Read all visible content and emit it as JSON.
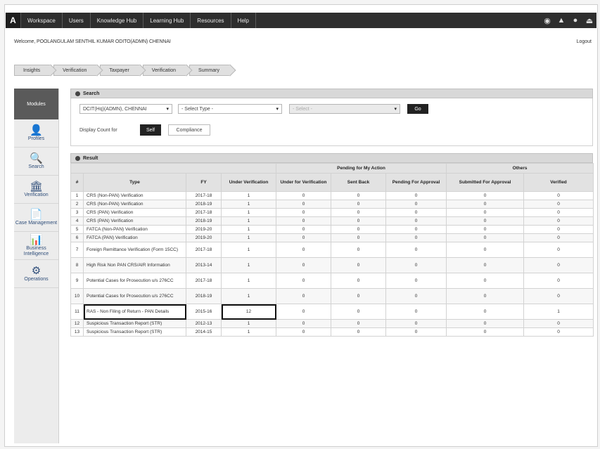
{
  "topbar": {
    "home": "A",
    "nav": [
      "Workspace",
      "Users",
      "Knowledge Hub",
      "Learning Hub",
      "Resources",
      "Help"
    ]
  },
  "welcome": {
    "text": "Welcome, POOLANGULAM SENTHIL KUMAR ODITO(ADMN) CHENNAI",
    "logout": "Logout"
  },
  "breadcrumbs": [
    "Insights",
    "Verification",
    "Taxpayer",
    "Verification",
    "Summary"
  ],
  "sidebar": {
    "header": "Modules",
    "items": [
      {
        "label": "Profiles",
        "icon": "👤"
      },
      {
        "label": "Search",
        "icon": "🔍"
      },
      {
        "label": "Verification",
        "icon": "🏛"
      },
      {
        "label": "Case Management",
        "icon": "📄"
      },
      {
        "label": "Business Intelligence",
        "icon": "📊"
      },
      {
        "label": "Operations",
        "icon": "⚙"
      }
    ]
  },
  "search": {
    "title": "Search",
    "jurisdiction": "DCIT(Hq)(ADMN), CHENNAI",
    "type_placeholder": "- Select Type -",
    "third_placeholder": "- Select -",
    "go": "Go",
    "display_label": "Display Count for",
    "self": "Self",
    "compliance": "Compliance"
  },
  "result": {
    "title": "Result",
    "headers": {
      "num": "#",
      "type": "Type",
      "fy": "FY",
      "under_verification": "Under Verification",
      "group_pending": "Pending for My Action",
      "group_others": "Others",
      "under_for_verification": "Under for Verification",
      "sent_back": "Sent Back",
      "pending_approval": "Pending For Approval",
      "submitted_approval": "Submitted For Approval",
      "verified": "Verified"
    },
    "rows": [
      {
        "n": "1",
        "type": "CRS (Non-PAN) Verification",
        "fy": "2017-18",
        "uv": "1",
        "ufv": "0",
        "sb": "0",
        "pa": "0",
        "sa": "0",
        "v": "0"
      },
      {
        "n": "2",
        "type": "CRS (Non-PAN) Verification",
        "fy": "2018-19",
        "uv": "1",
        "ufv": "0",
        "sb": "0",
        "pa": "0",
        "sa": "0",
        "v": "0"
      },
      {
        "n": "3",
        "type": "CRS (PAN) Verification",
        "fy": "2017-18",
        "uv": "1",
        "ufv": "0",
        "sb": "0",
        "pa": "0",
        "sa": "0",
        "v": "0"
      },
      {
        "n": "4",
        "type": "CRS (PAN) Verification",
        "fy": "2018-19",
        "uv": "1",
        "ufv": "0",
        "sb": "0",
        "pa": "0",
        "sa": "0",
        "v": "0"
      },
      {
        "n": "5",
        "type": "FATCA (Non-PAN) Verification",
        "fy": "2019-20",
        "uv": "1",
        "ufv": "0",
        "sb": "0",
        "pa": "0",
        "sa": "0",
        "v": "0"
      },
      {
        "n": "6",
        "type": "FATCA (PAN) Verification",
        "fy": "2019-20",
        "uv": "1",
        "ufv": "0",
        "sb": "0",
        "pa": "0",
        "sa": "0",
        "v": "0"
      },
      {
        "n": "7",
        "type": "Foreign Remittance Verification (Form 15CC)",
        "fy": "2017-18",
        "uv": "1",
        "ufv": "0",
        "sb": "0",
        "pa": "0",
        "sa": "0",
        "v": "0"
      },
      {
        "n": "8",
        "type": "High Risk Non PAN CRS/AIR Information",
        "fy": "2013-14",
        "uv": "1",
        "ufv": "0",
        "sb": "0",
        "pa": "0",
        "sa": "0",
        "v": "0"
      },
      {
        "n": "9",
        "type": "Potential Cases for Prosecution u/s 276CC",
        "fy": "2017-18",
        "uv": "1",
        "ufv": "0",
        "sb": "0",
        "pa": "0",
        "sa": "0",
        "v": "0"
      },
      {
        "n": "10",
        "type": "Potential Cases for Prosecution u/s 276CC",
        "fy": "2018-19",
        "uv": "1",
        "ufv": "0",
        "sb": "0",
        "pa": "0",
        "sa": "0",
        "v": "0"
      },
      {
        "n": "11",
        "type": "RAS - Non Filing of Return - PAN Details",
        "fy": "2015-16",
        "uv": "12",
        "ufv": "0",
        "sb": "0",
        "pa": "0",
        "sa": "0",
        "v": "1"
      },
      {
        "n": "12",
        "type": "Suspicious Transaction Report (STR)",
        "fy": "2012-13",
        "uv": "1",
        "ufv": "0",
        "sb": "0",
        "pa": "0",
        "sa": "0",
        "v": "0"
      },
      {
        "n": "13",
        "type": "Suspicious Transaction Report (STR)",
        "fy": "2014-15",
        "uv": "1",
        "ufv": "0",
        "sb": "0",
        "pa": "0",
        "sa": "0",
        "v": "0"
      }
    ]
  }
}
